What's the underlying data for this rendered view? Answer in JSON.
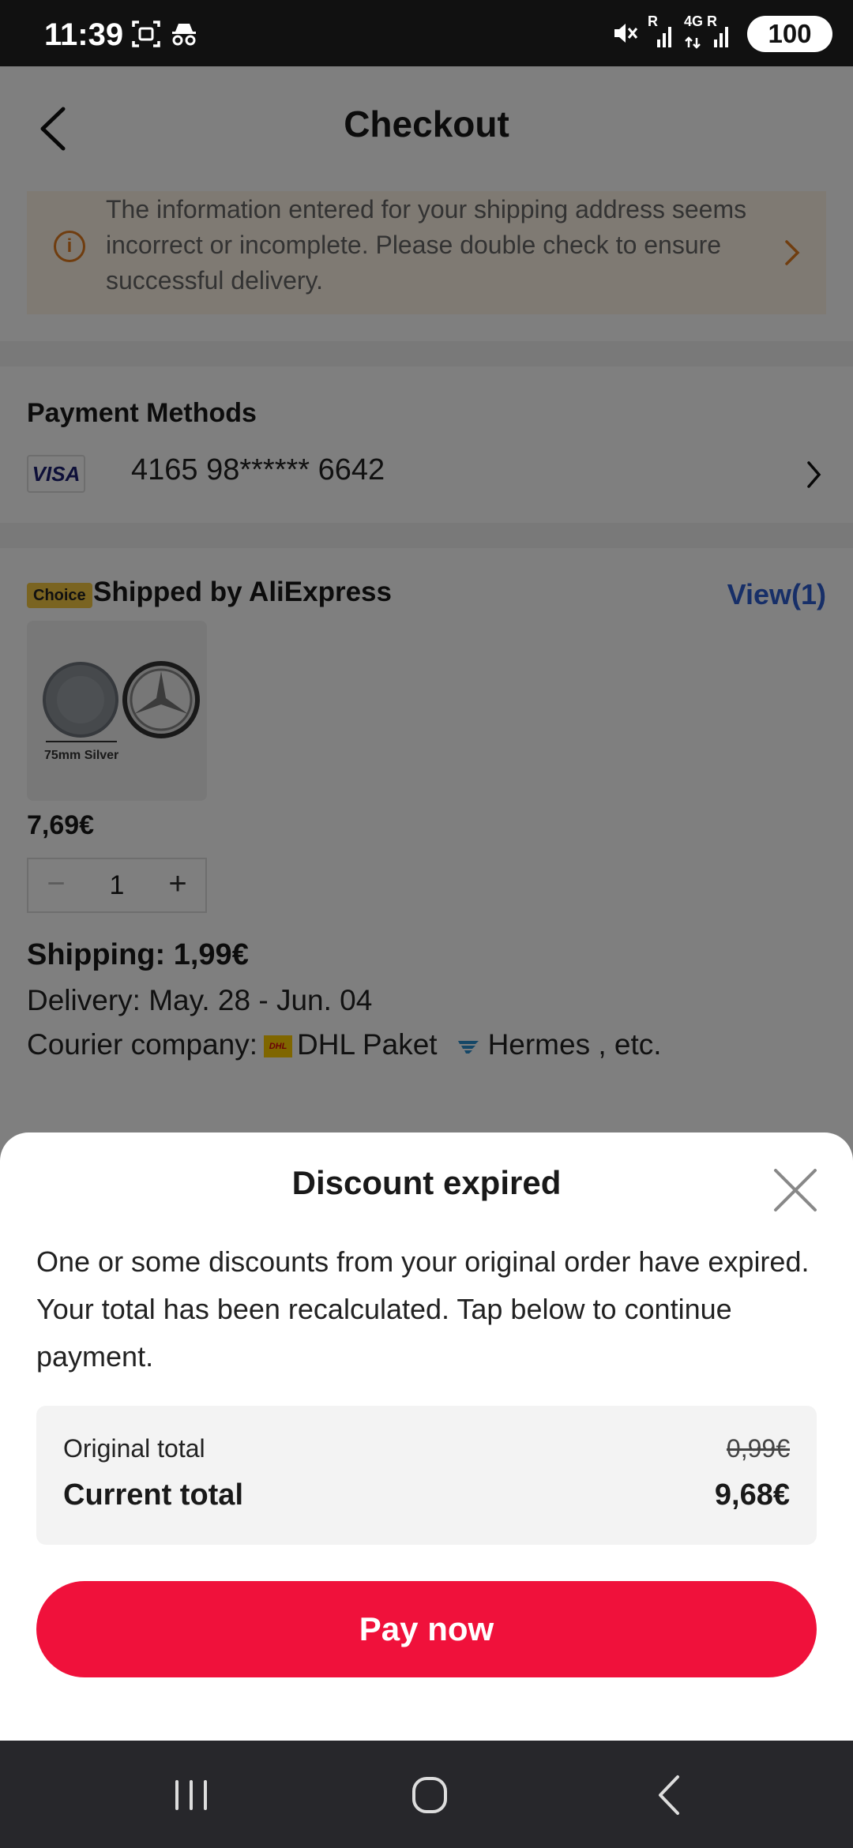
{
  "status_bar": {
    "time": "11:39",
    "battery": "100",
    "net1_top": "R",
    "net2_top": "4G R"
  },
  "header": {
    "title": "Checkout"
  },
  "warning": {
    "text": "The information entered for your shipping address seems incorrect or incomplete. Please double check to ensure successful delivery."
  },
  "payment": {
    "title": "Payment Methods",
    "card_brand": "VISA",
    "card_number": "4165 98****** 6642"
  },
  "shipment": {
    "badge": "Choice",
    "title": "Shipped by AliExpress",
    "view_link": "View(1)",
    "product_caption": "75mm Silver",
    "price": "7,69€",
    "quantity": "1",
    "shipping_fee": "Shipping: 1,99€",
    "delivery": "Delivery: May. 28 - Jun. 04",
    "courier_label": "Courier company:",
    "courier_1_logo": "DHL",
    "courier_1": "DHL Paket",
    "courier_2": "Hermes , etc."
  },
  "sheet": {
    "title": "Discount expired",
    "message": "One or some discounts from your original order have expired. Your total has been recalculated. Tap below to continue payment.",
    "original_label": "Original total",
    "original_value": "0,99€",
    "current_label": "Current total",
    "current_value": "9,68€",
    "pay_button": "Pay now"
  },
  "colors": {
    "accent": "#f0113b",
    "link": "#2e5fd1",
    "warning_bg": "#fff4e6",
    "warning_icon": "#e07a1f"
  }
}
